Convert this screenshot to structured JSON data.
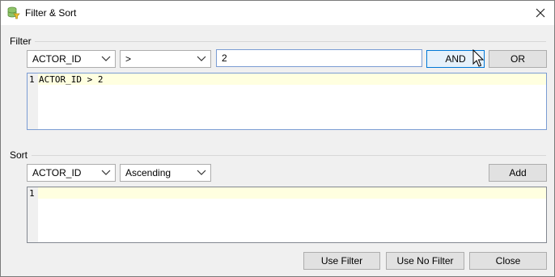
{
  "window": {
    "title": "Filter & Sort",
    "icon": "database-filter-icon",
    "close_icon": "close-icon"
  },
  "filter": {
    "section_label": "Filter",
    "column_select": {
      "selected": "ACTOR_ID"
    },
    "operator_select": {
      "selected": ">"
    },
    "value_input": {
      "value": "2"
    },
    "and_label": "AND",
    "or_label": "OR",
    "editor": {
      "line_number": "1",
      "text": "ACTOR_ID > 2"
    }
  },
  "sort": {
    "section_label": "Sort",
    "column_select": {
      "selected": "ACTOR_ID"
    },
    "order_select": {
      "selected": "Ascending"
    },
    "add_label": "Add",
    "editor": {
      "line_number": "1",
      "text": ""
    }
  },
  "footer": {
    "use_filter_label": "Use Filter",
    "use_no_filter_label": "Use No Filter",
    "close_label": "Close"
  },
  "colors": {
    "current_line": "#ffffe0",
    "button_hover": "#e5f1fb",
    "accent_border": "#0078d7"
  }
}
